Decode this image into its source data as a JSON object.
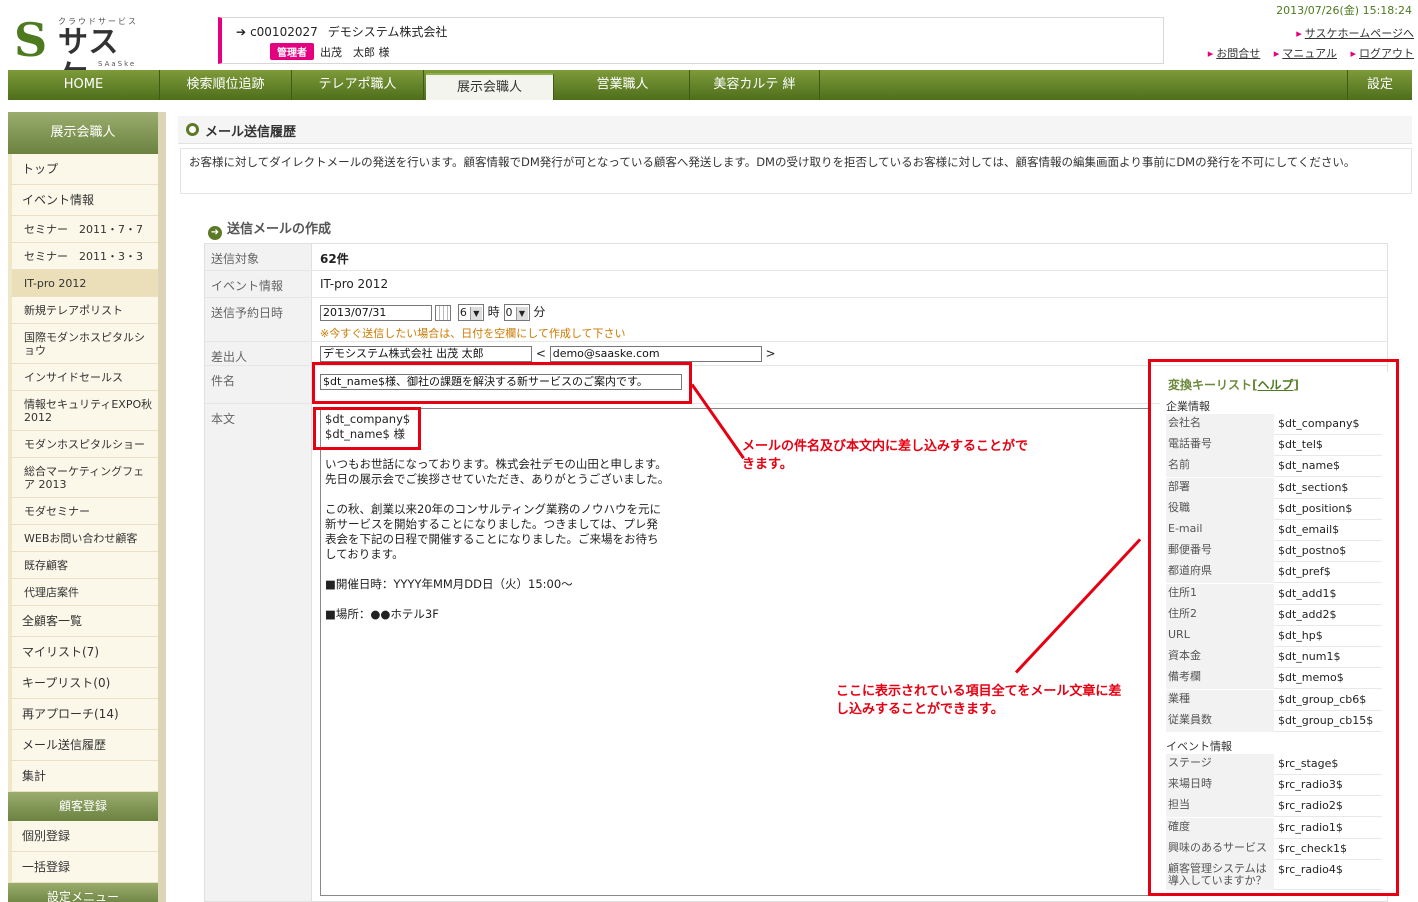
{
  "header": {
    "logo_sub": "クラウドサービス",
    "logo_text": "サスケ",
    "logo_en": "SAaSke",
    "user_id": "c00102027",
    "company": "デモシステム株式会社",
    "role_badge": "管理者",
    "user_name": "出茂　太郎 様",
    "datetime": "2013/07/26(金) 15:18:24",
    "links_top": [
      "サスケホームページへ"
    ],
    "links_bottom": [
      "お問合せ",
      "マニュアル",
      "ログアウト"
    ]
  },
  "nav": {
    "items": [
      "HOME",
      "検索順位追跡",
      "テレアポ職人",
      "展示会職人",
      "営業職人",
      "美容カルテ 絆"
    ],
    "settings": "設定"
  },
  "sidebar": {
    "head1": "展示会職人",
    "items_a": [
      "トップ",
      "イベント情報"
    ],
    "events": [
      "セミナー　2011・7・7",
      "セミナー　2011・3・3",
      "IT-pro 2012",
      "新規テレアポリスト",
      "国際モダンホスピタルショウ",
      "インサイドセールス",
      "情報セキュリティEXPO秋　2012",
      "モダンホスピタルショー",
      "総合マーケティングフェア 2013",
      "モダセミナー",
      "WEBお問い合わせ顧客",
      "既存顧客",
      "代理店案件"
    ],
    "items_b": [
      "全顧客一覧",
      "マイリスト(7)",
      "キープリスト(0)",
      "再アプローチ(14)",
      "メール送信履歴",
      "集計"
    ],
    "head2": "顧客登録",
    "items_c": [
      "個別登録",
      "一括登録"
    ],
    "head3": "設定メニュー"
  },
  "page": {
    "title": "メール送信履歴",
    "description": "お客様に対してダイレクトメールの発送を行います。顧客情報でDM発行が可となっている顧客へ発送します。DMの受け取りを拒否しているお客様に対しては、顧客情報の編集画面より事前にDMの発行を不可にしてください。",
    "section_title": "送信メールの作成"
  },
  "form": {
    "target_label": "送信対象",
    "target_value": "62件",
    "event_label": "イベント情報",
    "event_value": "IT-pro 2012",
    "schedule_label": "送信予約日時",
    "schedule_date": "2013/07/31",
    "schedule_hour": "6",
    "hour_unit": "時",
    "schedule_min": "0",
    "min_unit": "分",
    "schedule_note": "※今すぐ送信したい場合は、日付を空欄にして作成して下さい",
    "sender_label": "差出人",
    "sender_name": "デモシステム株式会社 出茂 太郎",
    "sender_lt": "<",
    "sender_email": "demo@saaske.com",
    "sender_gt": ">",
    "subject_label": "件名",
    "subject_value": "$dt_name$様、御社の課題を解決する新サービスのご案内です。",
    "body_label": "本文",
    "body_value": "$dt_company$\n$dt_name$ 様\n\nいつもお世話になっております。株式会社デモの山田と申します。\n先日の展示会でご挨拶させていただき、ありがとうございました。\n\nこの秋、創業以来20年のコンサルティング業務のノウハウを元に\n新サービスを開始することになりました。つきましては、プレ発\n表会を下記の日程で開催することになりました。ご来場をお待ち\nしております。\n\n■開催日時：YYYY年MM月DD日（火）15:00～\n\n■場所：●●ホテル3F"
  },
  "keylist": {
    "title": "変換キーリスト",
    "help": "ヘルプ",
    "group1": "企業情報",
    "rows1": [
      {
        "k": "会社名",
        "v": "$dt_company$"
      },
      {
        "k": "電話番号",
        "v": "$dt_tel$"
      },
      {
        "k": "名前",
        "v": "$dt_name$"
      },
      {
        "k": "部署",
        "v": "$dt_section$"
      },
      {
        "k": "役職",
        "v": "$dt_position$"
      },
      {
        "k": "E-mail",
        "v": "$dt_email$"
      },
      {
        "k": "郵便番号",
        "v": "$dt_postno$"
      },
      {
        "k": "都道府県",
        "v": "$dt_pref$"
      },
      {
        "k": "住所1",
        "v": "$dt_add1$"
      },
      {
        "k": "住所2",
        "v": "$dt_add2$"
      },
      {
        "k": "URL",
        "v": "$dt_hp$"
      },
      {
        "k": "資本金",
        "v": "$dt_num1$"
      },
      {
        "k": "備考欄",
        "v": "$dt_memo$"
      },
      {
        "k": "業種",
        "v": "$dt_group_cb6$"
      },
      {
        "k": "従業員数",
        "v": "$dt_group_cb15$"
      }
    ],
    "group2": "イベント情報",
    "rows2": [
      {
        "k": "ステージ",
        "v": "$rc_stage$"
      },
      {
        "k": "来場日時",
        "v": "$rc_radio3$"
      },
      {
        "k": "担当",
        "v": "$rc_radio2$"
      },
      {
        "k": "確度",
        "v": "$rc_radio1$"
      },
      {
        "k": "興味のあるサービス",
        "v": "$rc_check1$"
      },
      {
        "k": "顧客管理システムは導入していますか？",
        "v": "$rc_radio4$"
      }
    ]
  },
  "annotations": {
    "note1": "メールの件名及び本文内に差し込みすることができます。",
    "note2": "ここに表示されている項目全てをメール文章に差し込みすることができます。"
  }
}
